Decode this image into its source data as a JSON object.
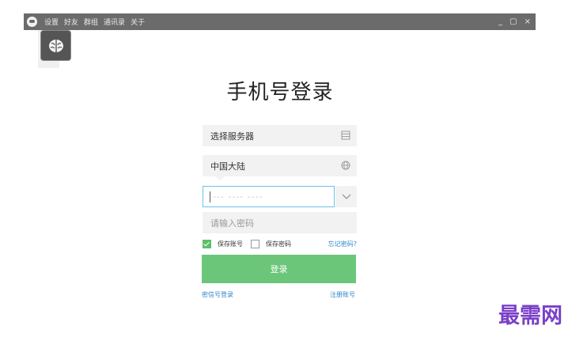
{
  "titlebar": {
    "menu": [
      "设置",
      "好友",
      "群组",
      "通讯录",
      "关于"
    ],
    "controls": {
      "minimize": "_",
      "maximize": "▢",
      "close": "×"
    }
  },
  "login": {
    "title": "手机号登录",
    "server_select": "选择服务器",
    "region": "中国大陆",
    "phone_placeholder": "--- ---- ----",
    "password_placeholder": "请输入密码",
    "save_account_label": "保存账号",
    "save_password_label": "保存密码",
    "save_account_checked": true,
    "save_password_checked": false,
    "forgot_label": "忘记密码?",
    "login_button": "登录",
    "alt_login_link": "密信号登录",
    "register_link": "注册账号"
  },
  "watermark": "最需网",
  "colors": {
    "accent_green": "#6bc67a",
    "link_blue": "#2f86c9",
    "input_focus": "#6cc2e8",
    "titlebar": "#6b6b6b",
    "watermark": "#7a3fc8"
  },
  "icons": {
    "app": "brain-icon",
    "server": "list-icon",
    "region": "globe-icon",
    "dropdown": "chevron-down-icon"
  }
}
